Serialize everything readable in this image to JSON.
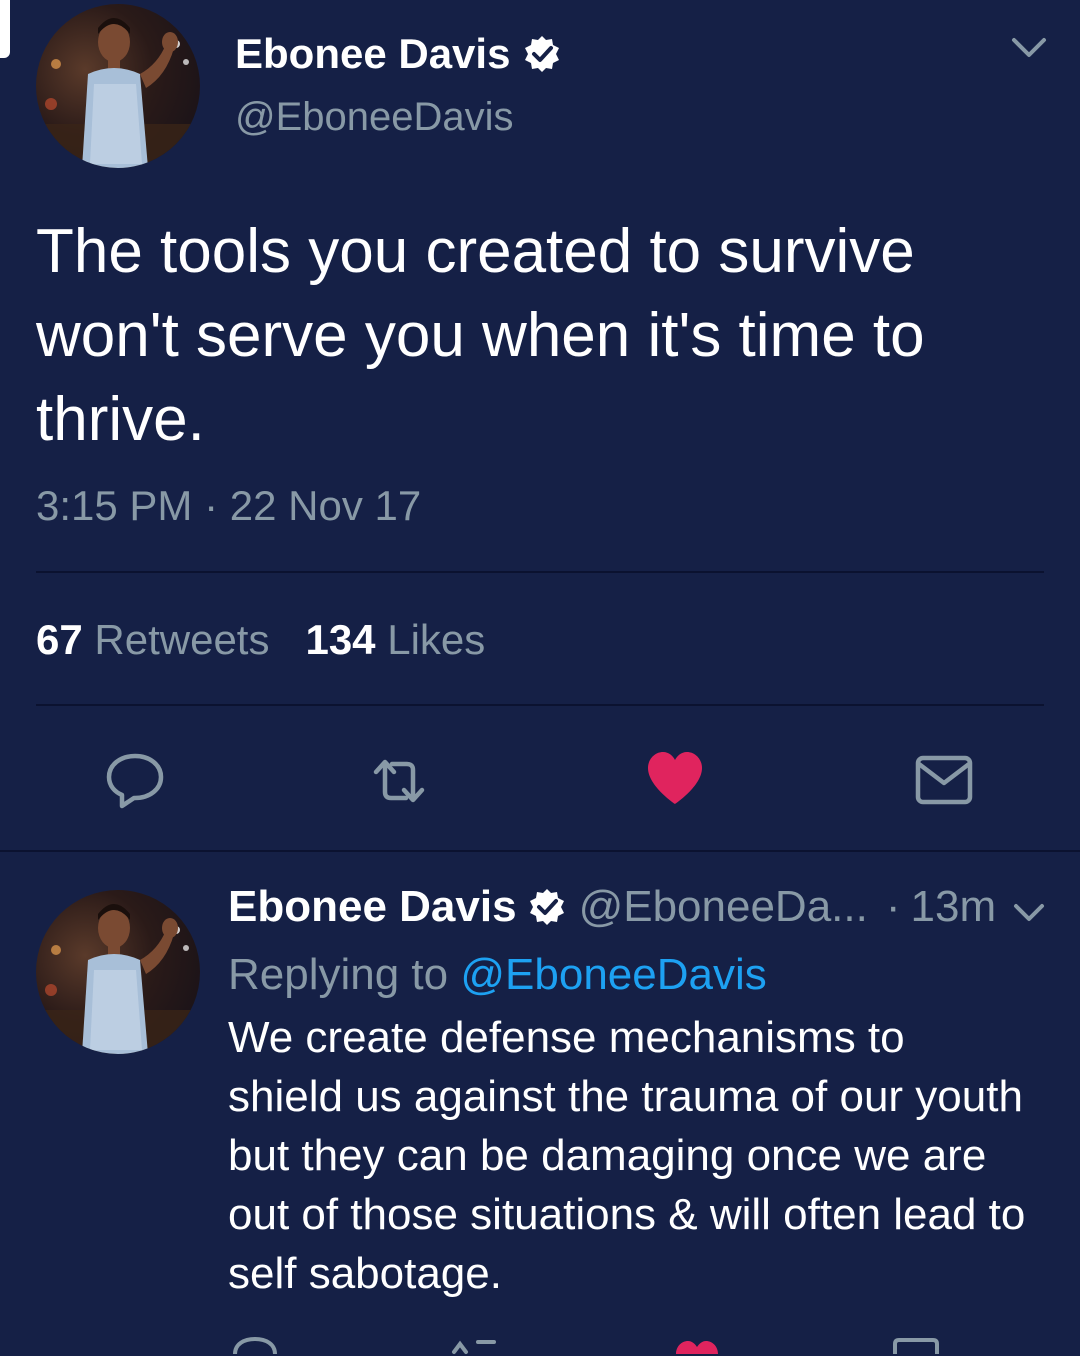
{
  "main_tweet": {
    "name": "Ebonee Davis",
    "handle": "@EboneeDavis",
    "text": "The tools you created to survive won't serve you when it's time to thrive.",
    "timestamp": "3:15 PM · 22 Nov 17",
    "retweets_count": "67",
    "retweets_label": "Retweets",
    "likes_count": "134",
    "likes_label": "Likes",
    "liked": true
  },
  "reply_tweet": {
    "name": "Ebonee Davis",
    "handle": "@EboneeDa...",
    "separator": "·",
    "time": "13m",
    "replying_prefix": "Replying to",
    "replying_to": "@EboneeDavis",
    "text": "We create defense mechanisms to shield us against the trauma of our youth but they can be damaging once we are out of those situations & will often lead to self sabotage."
  },
  "icons": {
    "verified": "verified-badge-icon",
    "chevron": "chevron-down-icon",
    "reply": "reply-bubble-icon",
    "retweet": "retweet-icon",
    "like": "heart-icon",
    "dm": "envelope-icon"
  },
  "colors": {
    "background": "#152046",
    "secondary_text": "#8899a6",
    "mention": "#1da1f2",
    "like": "#e0245e"
  }
}
